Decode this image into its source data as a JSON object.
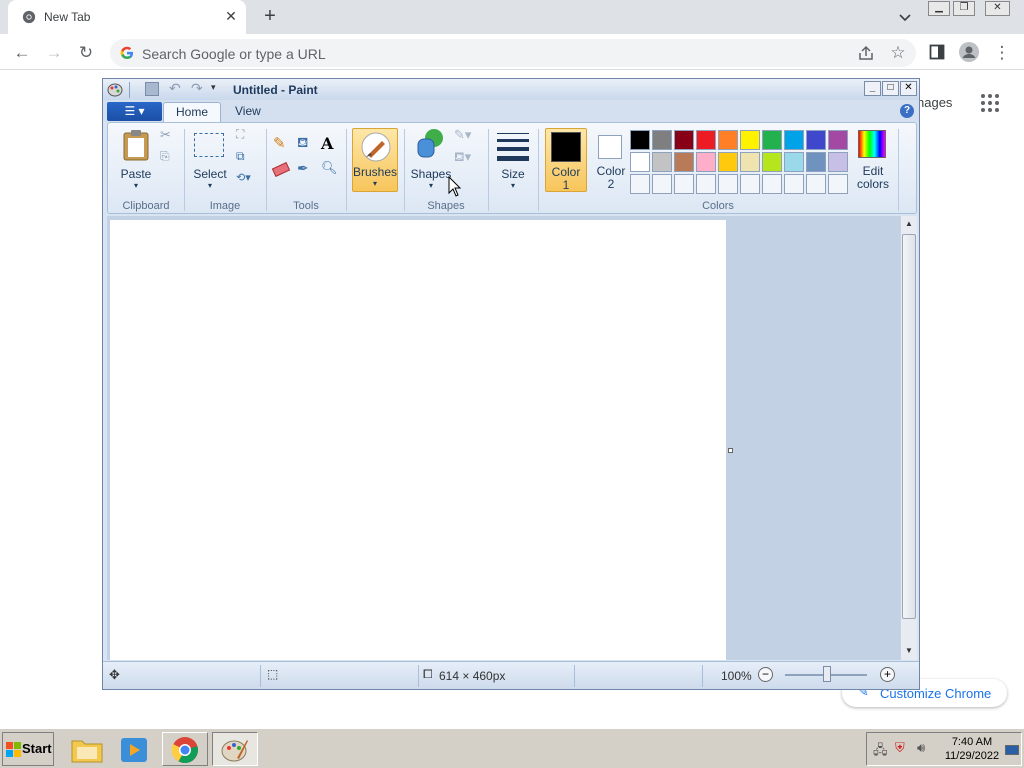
{
  "browser": {
    "tab_title": "New Tab",
    "omnibox_placeholder": "Search Google or type a URL",
    "ntp_images_link": "nages",
    "customize_label": "Customize Chrome"
  },
  "paint": {
    "title": "Untitled - Paint",
    "tabs": {
      "home": "Home",
      "view": "View"
    },
    "ribbon": {
      "paste": "Paste",
      "select": "Select",
      "brushes": "Brushes",
      "shapes": "Shapes",
      "size": "Size",
      "color1_line1": "Color",
      "color1_line2": "1",
      "color2_line1": "Color",
      "color2_line2": "2",
      "edit_colors_line1": "Edit",
      "edit_colors_line2": "colors",
      "groups": {
        "clipboard": "Clipboard",
        "image": "Image",
        "tools": "Tools",
        "shapes": "Shapes",
        "colors": "Colors"
      }
    },
    "palette_row1": [
      "#000000",
      "#7f7f7f",
      "#880015",
      "#ed1c24",
      "#ff7f27",
      "#fff200",
      "#22b14c",
      "#00a2e8",
      "#3f48cc",
      "#a349a4"
    ],
    "palette_row2": [
      "#ffffff",
      "#c3c3c3",
      "#b97a57",
      "#ffaec9",
      "#ffc90e",
      "#efe4b0",
      "#b5e61d",
      "#99d9ea",
      "#7092be",
      "#c8bfe7"
    ],
    "color1": "#000000",
    "color2": "#ffffff",
    "status": {
      "canvas_size": "614 × 460px",
      "zoom": "100%"
    }
  },
  "taskbar": {
    "start": "Start",
    "time": "7:40 AM",
    "date": "11/29/2022"
  }
}
